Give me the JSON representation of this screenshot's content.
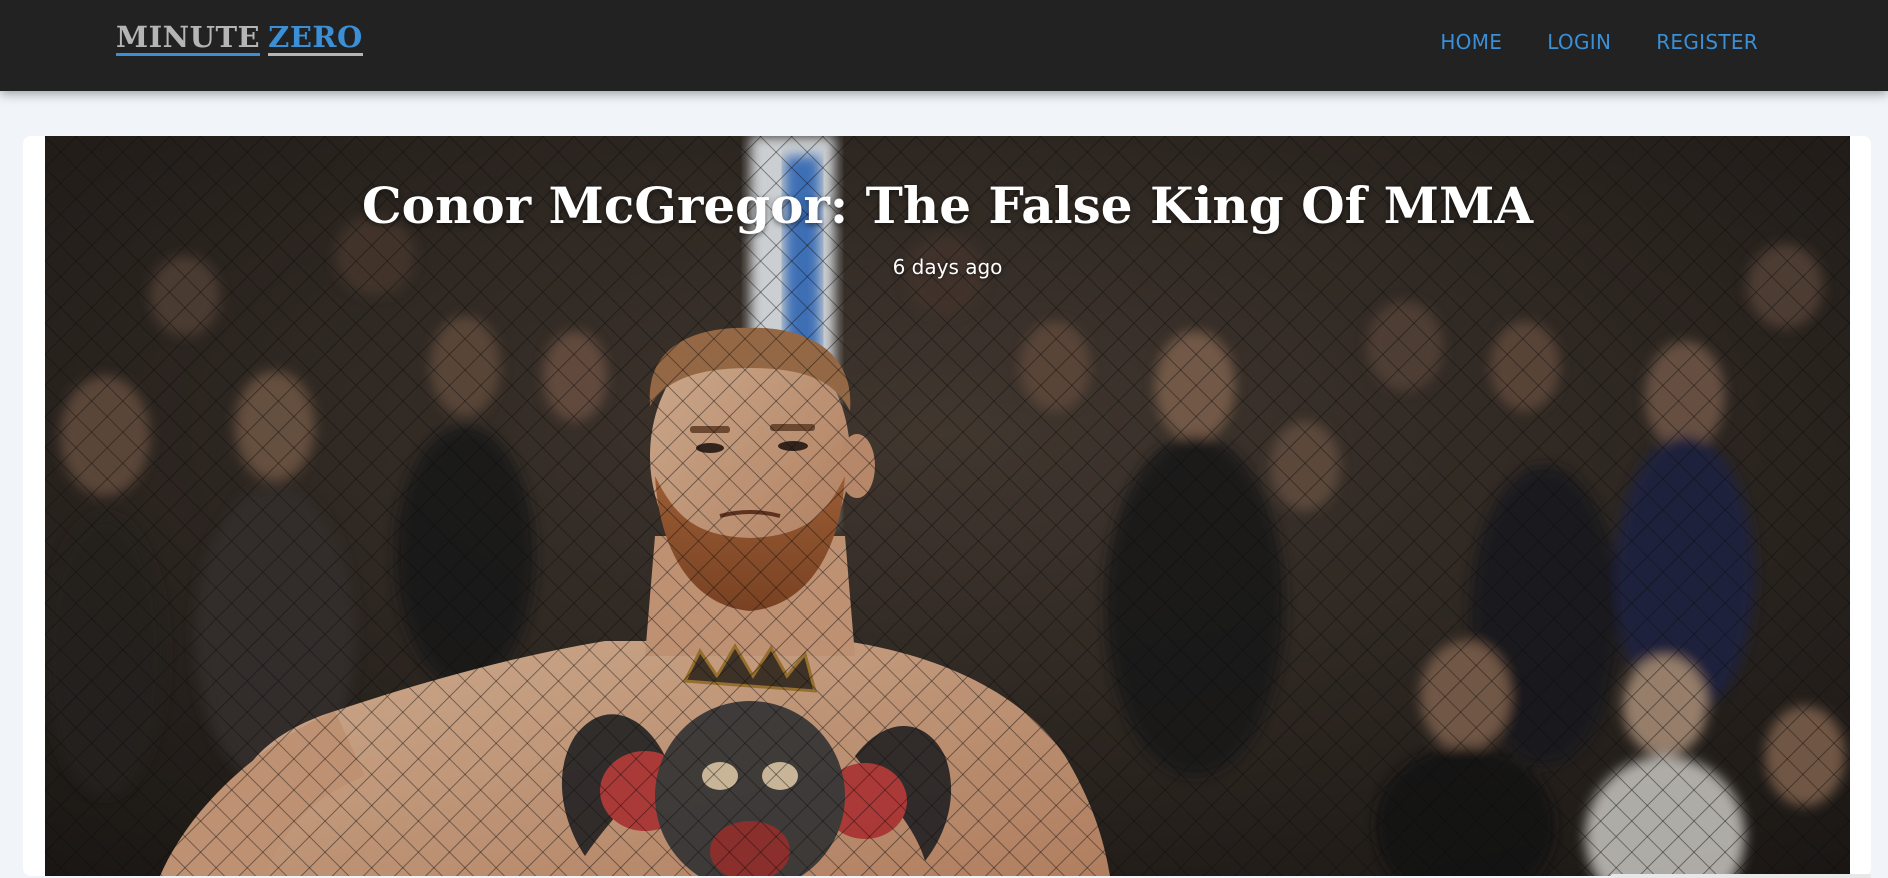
{
  "brand": {
    "word1": "MINUTE",
    "word2": "ZERO"
  },
  "nav": {
    "items": [
      {
        "label": "HOME"
      },
      {
        "label": "LOGIN"
      },
      {
        "label": "REGISTER"
      }
    ]
  },
  "article": {
    "title": "Conor McGregor: The False King Of MMA",
    "date": "6 days ago",
    "image": "fighter-in-octagon-photo"
  },
  "colors": {
    "navbar_bg": "#222222",
    "accent": "#3a8fd6",
    "page_bg": "#f1f5f9"
  }
}
